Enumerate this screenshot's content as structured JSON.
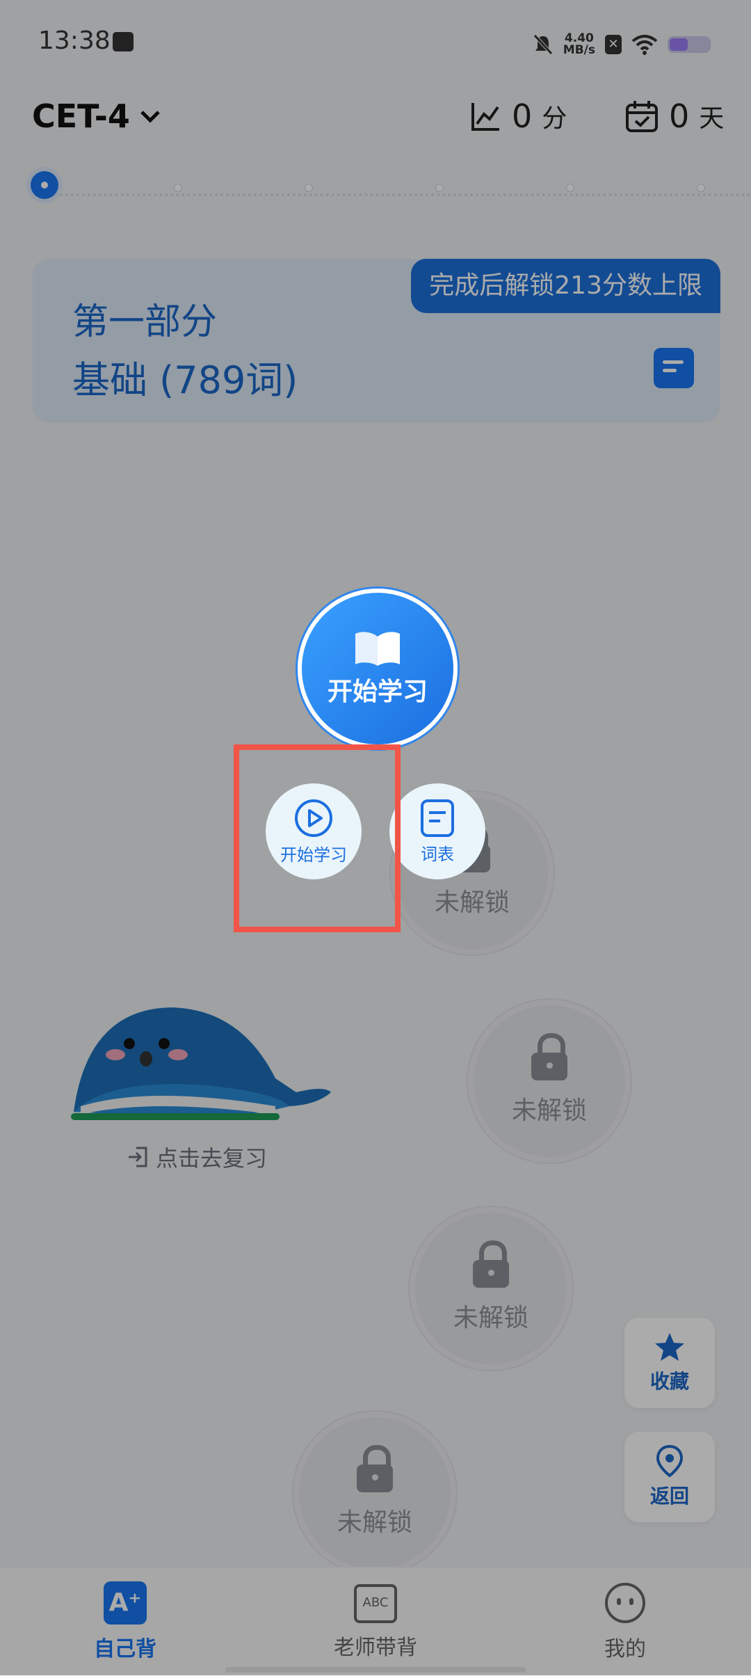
{
  "status_bar": {
    "time": "13:38",
    "speed_value": "4.40",
    "speed_unit": "MB/s"
  },
  "header": {
    "book": "CET-4",
    "score": "0",
    "score_unit": "分",
    "days": "0",
    "days_unit": "天"
  },
  "section": {
    "title": "第一部分",
    "subtitle": "基础 (789词)",
    "unlock_hint": "完成后解锁213分数上限"
  },
  "nodes": [
    {
      "label": "未解锁"
    },
    {
      "label": "未解锁"
    },
    {
      "label": "未解锁"
    },
    {
      "label": "未解锁"
    }
  ],
  "review": {
    "label": "点击去复习"
  },
  "popup": {
    "main_label": "开始学习",
    "start_label": "开始学习",
    "wordlist_label": "词表"
  },
  "side_buttons": {
    "favorites": "收藏",
    "back": "返回"
  },
  "bottom_nav": [
    {
      "label": "自己背",
      "active": true
    },
    {
      "label": "老师带背",
      "active": false
    },
    {
      "label": "我的",
      "active": false
    }
  ],
  "colors": {
    "accent": "#1877f2",
    "highlight": "#f25448"
  }
}
